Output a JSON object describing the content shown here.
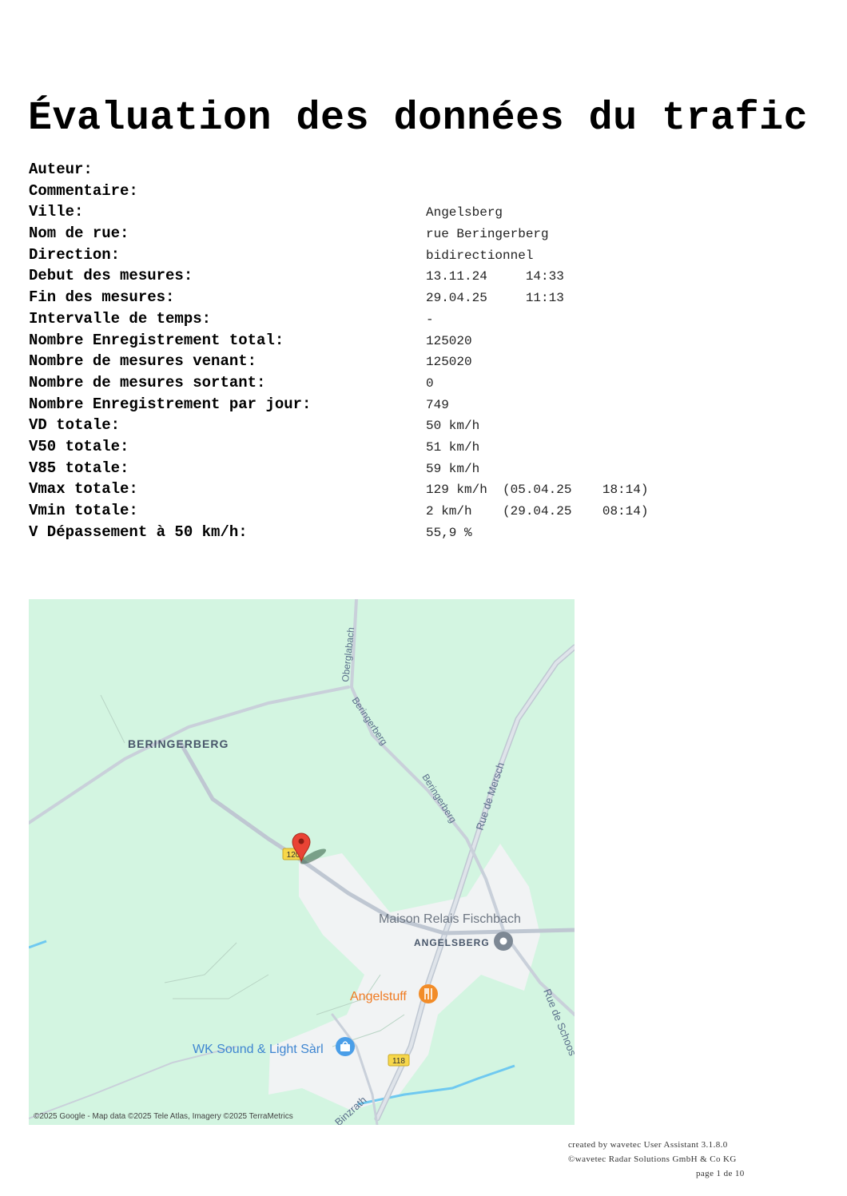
{
  "document": {
    "title": "Évaluation des données du trafic"
  },
  "fields": [
    {
      "label": "Auteur:",
      "value": ""
    },
    {
      "label": "Commentaire:",
      "value": ""
    },
    {
      "label": "Ville:",
      "value": "Angelsberg"
    },
    {
      "label": "Nom de rue:",
      "value": "rue Beringerberg"
    },
    {
      "label": "Direction:",
      "value": "bidirectionnel"
    },
    {
      "label": "Debut des mesures:",
      "value": "13.11.24     14:33"
    },
    {
      "label": "Fin des mesures:",
      "value": "29.04.25     11:13"
    },
    {
      "label": "Intervalle de temps:",
      "value": "-"
    },
    {
      "label": "Nombre Enregistrement total:",
      "value": "125020"
    },
    {
      "label": "Nombre de mesures venant:",
      "value": "125020"
    },
    {
      "label": "Nombre de mesures sortant:",
      "value": "0"
    },
    {
      "label": "Nombre Enregistrement par jour:",
      "value": "749"
    },
    {
      "label": "VD totale:",
      "value": "50 km/h"
    },
    {
      "label": "V50 totale:",
      "value": "51 km/h"
    },
    {
      "label": "V85 totale:",
      "value": "59 km/h"
    },
    {
      "label": "Vmax totale:",
      "value": "129 km/h  (05.04.25    18:14)"
    },
    {
      "label": "Vmin totale:",
      "value": "2 km/h    (29.04.25    08:14)"
    },
    {
      "label": "V Dépassement à 50 km/h:",
      "value": "55,9 %"
    }
  ],
  "map": {
    "labels": {
      "locality_beringerberg": "BERINGERBERG",
      "street_oberglabach": "Oberglabach",
      "street_beringerberg_1": "Beringerberg",
      "street_beringerberg_2": "Beringerberg",
      "street_rue_de_mersch": "Rue de Mersch",
      "poi_maison_relais": "Maison Relais Fischbach",
      "locality_angelsberg": "ANGELSBERG",
      "poi_angelstuff": "Angelstuff",
      "street_rue_de_schoos": "Rue de Schoos",
      "poi_wk_sound": "WK Sound & Light Sàrl",
      "road_shield_118": "118",
      "road_shield_120": "120",
      "street_binzrath": "Binzrath",
      "attribution": "©2025 Google - Map data ©2025 Tele Atlas, Imagery ©2025 TerraMetrics"
    },
    "icons": {
      "marker": "red-map-pin-icon",
      "maison_relais": "gray-place-pin-icon",
      "angelstuff": "restaurant-pin-icon",
      "wk_sound": "shopping-bag-pin-icon"
    },
    "colors": {
      "land": "#d3f5e1",
      "built_area": "#f1f3f4",
      "road": "#c5ccd6",
      "water": "#6fc9f0",
      "marker": "#e94335",
      "restaurant": "#f28c28",
      "shop": "#4a9ee8"
    }
  },
  "footer": {
    "created_by": "created by wavetec User Assistant 3.1.8.0",
    "copyright": "©wavetec Radar Solutions GmbH & Co KG",
    "page": "page 1 de 10"
  }
}
